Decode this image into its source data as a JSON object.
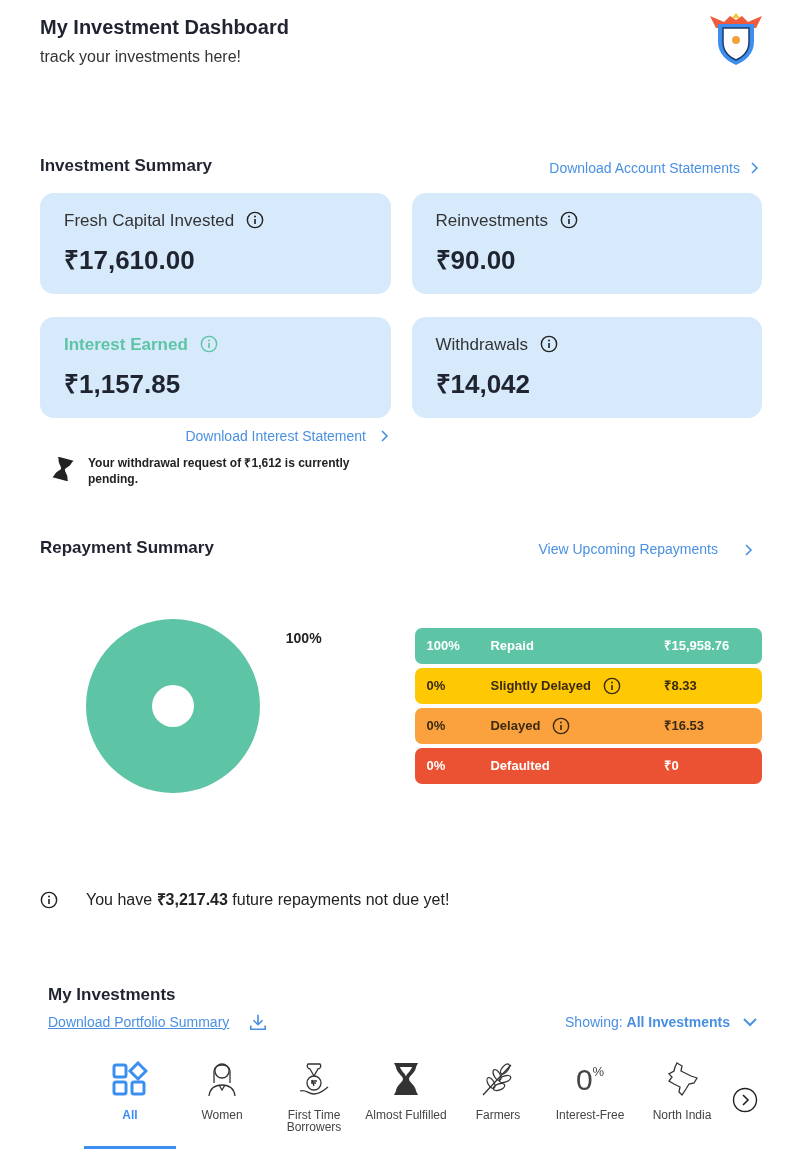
{
  "header": {
    "title": "My Investment Dashboard",
    "subtitle": "track your investments here!"
  },
  "investment_summary": {
    "title": "Investment Summary",
    "link": "Download Account Statements",
    "cards": [
      {
        "label": "Fresh Capital Invested",
        "value": "₹17,610.00",
        "highlighted": false
      },
      {
        "label": "Reinvestments",
        "value": "₹90.00",
        "highlighted": false
      },
      {
        "label": "Interest Earned",
        "value": "₹1,157.85",
        "highlighted": true
      },
      {
        "label": "Withdrawals",
        "value": "₹14,042",
        "highlighted": false
      }
    ],
    "interest_link": "Download Interest Statement",
    "pending_notice": "Your withdrawal request of ₹1,612 is currently pending."
  },
  "repayment_summary": {
    "title": "Repayment Summary",
    "link": "View Upcoming Repayments",
    "chart_data": {
      "type": "pie",
      "values": [
        100
      ],
      "value_labels": [
        "100%"
      ]
    },
    "rows": [
      {
        "percent": "100%",
        "label": "Repaid",
        "amount": "₹15,958.76",
        "info": false,
        "color": "#5ec4a6"
      },
      {
        "percent": "0%",
        "label": "Slightly Delayed",
        "amount": "₹8.33",
        "info": true,
        "color": "#fec803"
      },
      {
        "percent": "0%",
        "label": "Delayed",
        "amount": "₹16.53",
        "info": true,
        "color": "#fba23f"
      },
      {
        "percent": "0%",
        "label": "Defaulted",
        "amount": "₹0",
        "info": false,
        "color": "#eb5233"
      }
    ],
    "future_note": "You have **₹3,217.43** future repayments not due yet!"
  },
  "my_investments": {
    "title": "My Investments",
    "download_link": "Download Portfolio Summary",
    "filter_label": "Showing:",
    "filter_value": "All Investments",
    "categories": [
      {
        "kind": "grid",
        "label": "All",
        "selected": true
      },
      {
        "kind": "woman",
        "label": "Women",
        "selected": false
      },
      {
        "kind": "money",
        "label": "First Time Borrowers",
        "selected": false
      },
      {
        "kind": "hourglass",
        "label": "Almost Fulfilled",
        "selected": false
      },
      {
        "kind": "wheat",
        "label": "Farmers",
        "selected": false
      },
      {
        "kind": "percent",
        "label": "Interest-Free",
        "glyph": "0",
        "glyph_sup": "%",
        "selected": false
      },
      {
        "kind": "map",
        "label": "North India",
        "selected": false
      }
    ]
  }
}
